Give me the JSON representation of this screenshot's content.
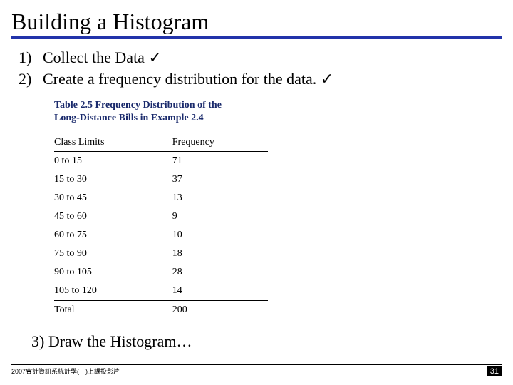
{
  "title": "Building a Histogram",
  "steps": {
    "one_num": "1)",
    "one_text": "Collect the Data",
    "two_num": "2)",
    "two_text": "Create a frequency distribution for the data.",
    "three_text": "3) Draw the Histogram…",
    "check": "✓"
  },
  "table": {
    "caption_line1": "Table 2.5 Frequency Distribution of the",
    "caption_line2": "Long-Distance Bills in Example 2.4",
    "head_class": "Class Limits",
    "head_freq": "Frequency",
    "rows": [
      {
        "class": "0 to 15",
        "freq": "71"
      },
      {
        "class": "15 to 30",
        "freq": "37"
      },
      {
        "class": "30 to 45",
        "freq": "13"
      },
      {
        "class": "45 to 60",
        "freq": "9"
      },
      {
        "class": "60 to 75",
        "freq": "10"
      },
      {
        "class": "75 to 90",
        "freq": "18"
      },
      {
        "class": "90 to 105",
        "freq": "28"
      },
      {
        "class": "105 to 120",
        "freq": "14"
      }
    ],
    "total_label": "Total",
    "total_value": "200"
  },
  "footer": {
    "left": "2007會計資訊系統計學(一)上課投影片",
    "page": "31"
  },
  "chart_data": {
    "type": "table",
    "title": "Table 2.5 Frequency Distribution of the Long-Distance Bills in Example 2.4",
    "columns": [
      "Class Limits",
      "Frequency"
    ],
    "rows": [
      [
        "0 to 15",
        71
      ],
      [
        "15 to 30",
        37
      ],
      [
        "30 to 45",
        13
      ],
      [
        "45 to 60",
        9
      ],
      [
        "60 to 75",
        10
      ],
      [
        "75 to 90",
        18
      ],
      [
        "90 to 105",
        28
      ],
      [
        "105 to 120",
        14
      ]
    ],
    "total": 200
  }
}
